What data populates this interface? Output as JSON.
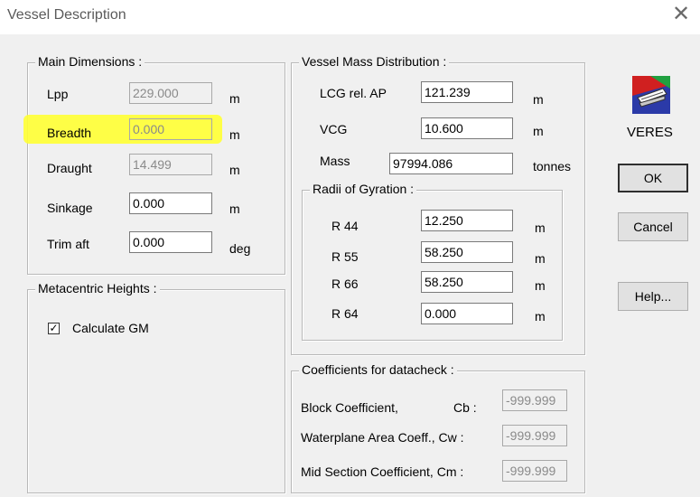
{
  "window": {
    "title": "Vessel Description"
  },
  "main_dimensions": {
    "title": "Main Dimensions :",
    "rows": [
      {
        "label": "Lpp",
        "value": "229.000",
        "unit": "m",
        "disabled": true
      },
      {
        "label": "Breadth",
        "value": "0.000",
        "unit": "m",
        "disabled": true,
        "highlighted": true
      },
      {
        "label": "Draught",
        "value": "14.499",
        "unit": "m",
        "disabled": true
      },
      {
        "label": "Sinkage",
        "value": "0.000",
        "unit": "m",
        "disabled": false
      },
      {
        "label": "Trim aft",
        "value": "0.000",
        "unit": "deg",
        "disabled": false
      }
    ]
  },
  "metacentric": {
    "title": "Metacentric Heights :",
    "checkbox_label": "Calculate GM",
    "checked": true
  },
  "mass_distribution": {
    "title": "Vessel Mass Distribution :",
    "lcg": {
      "label": "LCG rel. AP",
      "value": "121.239",
      "unit": "m"
    },
    "vcg": {
      "label": "VCG",
      "value": "10.600",
      "unit": "m"
    },
    "mass": {
      "label": "Mass",
      "value": "97994.086",
      "unit": "tonnes"
    },
    "radii": {
      "title": "Radii of Gyration :",
      "rows": [
        {
          "label": "R 44",
          "value": "12.250",
          "unit": "m"
        },
        {
          "label": "R 55",
          "value": "58.250",
          "unit": "m"
        },
        {
          "label": "R 66",
          "value": "58.250",
          "unit": "m"
        },
        {
          "label": "R 64",
          "value": "0.000",
          "unit": "m"
        }
      ]
    }
  },
  "coefficients": {
    "title": "Coefficients for datacheck :",
    "rows": [
      {
        "label": "Block Coefficient,",
        "symbol": "Cb :",
        "value": "-999.999"
      },
      {
        "label": "Waterplane Area Coeff., Cw :",
        "symbol": "",
        "value": "-999.999"
      },
      {
        "label": "Mid Section Coefficient, Cm :",
        "symbol": "",
        "value": "-999.999"
      }
    ]
  },
  "app": {
    "logo_label": "VERES"
  },
  "buttons": {
    "ok": "OK",
    "cancel": "Cancel",
    "help": "Help..."
  },
  "colors": {
    "highlight": "#ffff33",
    "disabled_text": "#8a8a8a"
  }
}
